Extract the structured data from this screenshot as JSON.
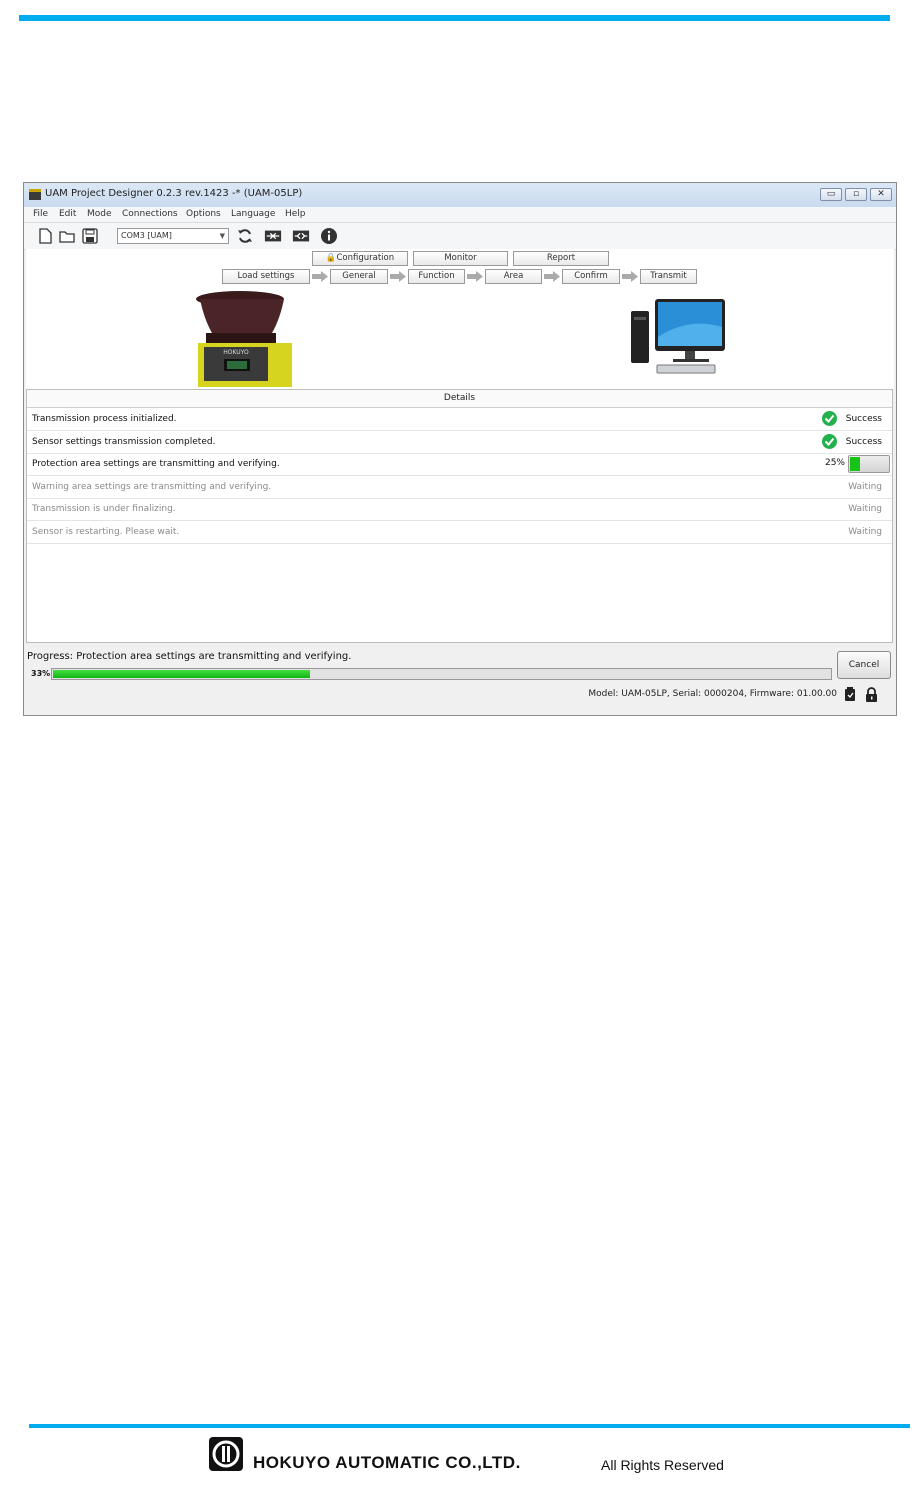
{
  "window": {
    "title": "UAM Project Designer 0.2.3 rev.1423 -* (UAM-05LP)",
    "controls": {
      "minimize": "▭",
      "maximize": "▫",
      "close": "✕"
    }
  },
  "menu": [
    "File",
    "Edit",
    "Mode",
    "Connections",
    "Options",
    "Language",
    "Help"
  ],
  "toolbar": {
    "port_value": "COM3 [UAM]",
    "icons": [
      "new-file-icon",
      "open-folder-icon",
      "save-icon",
      "refresh-icon",
      "connect-icon",
      "disconnect-icon",
      "info-icon"
    ]
  },
  "tabs_top": [
    "Configuration",
    "Monitor",
    "Report"
  ],
  "steps": [
    "Load settings",
    "General",
    "Function",
    "Area",
    "Confirm",
    "Transmit"
  ],
  "details": {
    "header": "Details",
    "rows": [
      {
        "message": "Transmission process initialized.",
        "status": "Success",
        "state": "success"
      },
      {
        "message": "Sensor settings transmission completed.",
        "status": "Success",
        "state": "success"
      },
      {
        "message": "Protection area settings are transmitting and verifying.",
        "status": "25%",
        "state": "progress",
        "progress": 0.25
      },
      {
        "message": "Warning area settings are transmitting and verifying.",
        "status": "Waiting",
        "state": "waiting"
      },
      {
        "message": "Transmission is under finalizing.",
        "status": "Waiting",
        "state": "waiting"
      },
      {
        "message": "Sensor is restarting. Please wait.",
        "status": "Waiting",
        "state": "waiting"
      }
    ]
  },
  "progress": {
    "label": "Progress: Protection area settings are transmitting and verifying.",
    "percent_text": "33%",
    "value": 0.33
  },
  "cancel_label": "Cancel",
  "status_bar": "Model: UAM-05LP, Serial: 0000204, Firmware: 01.00.00",
  "sensor_brand": "HOKUYO",
  "footer": {
    "company": "HOKUYO AUTOMATIC CO.,LTD.",
    "rights": "All Rights Reserved"
  },
  "colors": {
    "accent_line": "#00aeef",
    "progress_green": "#18c318",
    "success_green": "#22b14c"
  }
}
